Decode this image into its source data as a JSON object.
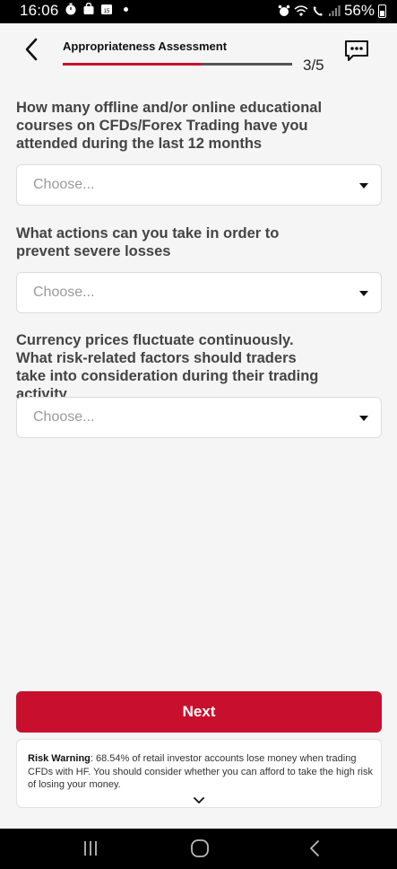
{
  "status_bar": {
    "time": "16:06",
    "battery": "56%",
    "left_icons": [
      "timer-icon",
      "bag-icon",
      "calendar-icon",
      "dot-icon"
    ],
    "right_icons": [
      "alarm-icon",
      "wifi-icon",
      "call-icon",
      "signal-icon",
      "battery-icon"
    ]
  },
  "header": {
    "title": "Appropriateness Assessment",
    "step": "3/5",
    "progress_fraction": 0.6,
    "accent_color": "#c8102e"
  },
  "questions": [
    {
      "text": "How many offline and/or online educational courses on CFDs/Forex Trading have you attended during the last 12 months",
      "placeholder": "Choose..."
    },
    {
      "text": "What actions can you take in order to prevent severe losses",
      "placeholder": "Choose..."
    },
    {
      "text": "Currency prices fluctuate continuously. What risk-related factors should traders take into consideration during their trading activity",
      "placeholder": "Choose..."
    }
  ],
  "next_button": {
    "label": "Next"
  },
  "risk_warning": {
    "label": "Risk Warning",
    "text": ": 68.54% of retail investor accounts lose money when trading CFDs with HF. You should consider whether you can afford to take the high risk of losing your money."
  },
  "nav_bar": {
    "icons": [
      "recent-apps-icon",
      "home-icon",
      "back-nav-icon"
    ]
  }
}
